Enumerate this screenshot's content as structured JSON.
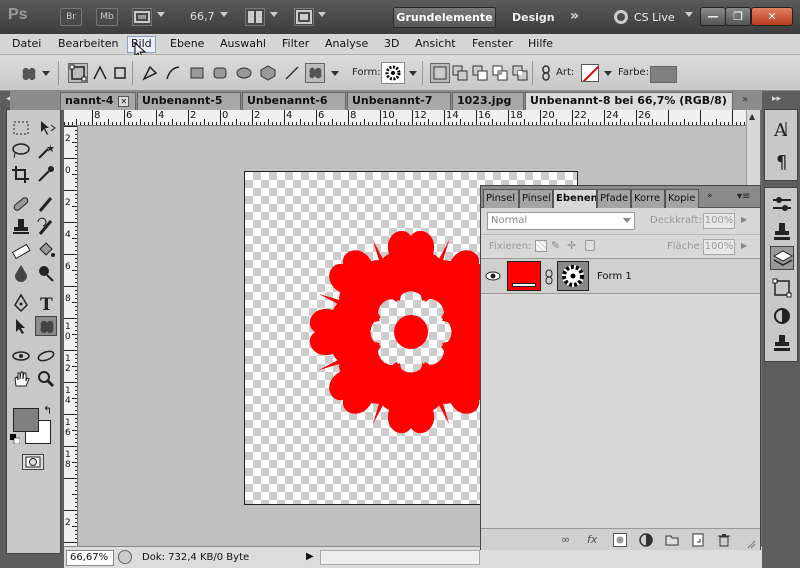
{
  "app": {
    "logo": "Ps",
    "bridge": "Br",
    "minibridge": "Mb",
    "zoom": "66,7",
    "workspace_active": "Grundelemente",
    "workspace_design": "Design",
    "workspace_more": "»",
    "cs_live": "CS Live",
    "win_minimize": "—",
    "win_restore": "❐",
    "win_close": "✕"
  },
  "menu": {
    "items": [
      "Datei",
      "Bearbeiten",
      "Bild",
      "Ebene",
      "Auswahl",
      "Filter",
      "Analyse",
      "3D",
      "Ansicht",
      "Fenster",
      "Hilfe"
    ]
  },
  "options": {
    "form_label": "Form:",
    "art_label": "Art:",
    "farbe_label": "Farbe:",
    "farbe_color": "#808080"
  },
  "tabs": [
    {
      "label": "nannt-4"
    },
    {
      "label": "Unbenannt-5"
    },
    {
      "label": "Unbenannt-6"
    },
    {
      "label": "Unbenannt-7"
    },
    {
      "label": "1023.jpg"
    },
    {
      "label": "Unbenannt-8 bei 66,7% (RGB/8) *"
    }
  ],
  "ruler": {
    "h_labels": [
      "8",
      "6",
      "4",
      "2",
      "0",
      "2",
      "4",
      "6",
      "8",
      "10",
      "12",
      "14",
      "16",
      "18",
      "20",
      "22",
      "24",
      "26"
    ],
    "v_labels": [
      "2",
      "0",
      "2",
      "4",
      "6",
      "8",
      "1 0",
      "1 2",
      "1 4",
      "1 6",
      "1 8",
      "2"
    ]
  },
  "status": {
    "zoom": "66,67%",
    "doc": "Dok: 732,4 KB/0 Byte"
  },
  "layers_panel": {
    "tabs": [
      "Pinsel",
      "Pinsel",
      "Ebenen",
      "Pfade",
      "Korre",
      "Kopie"
    ],
    "blend_mode": "Normal",
    "opacity_label": "Deckkraft:",
    "opacity_value": "100%",
    "lock_label": "Fixieren:",
    "fill_label": "Fläche:",
    "fill_value": "100%",
    "layer_name": "Form 1",
    "fill_color": "#ff0000"
  },
  "colors": {
    "foreground": "#808080",
    "background": "#ffffff",
    "shape": "#ff0000",
    "accent_active_tab": "#dcdcdc"
  }
}
